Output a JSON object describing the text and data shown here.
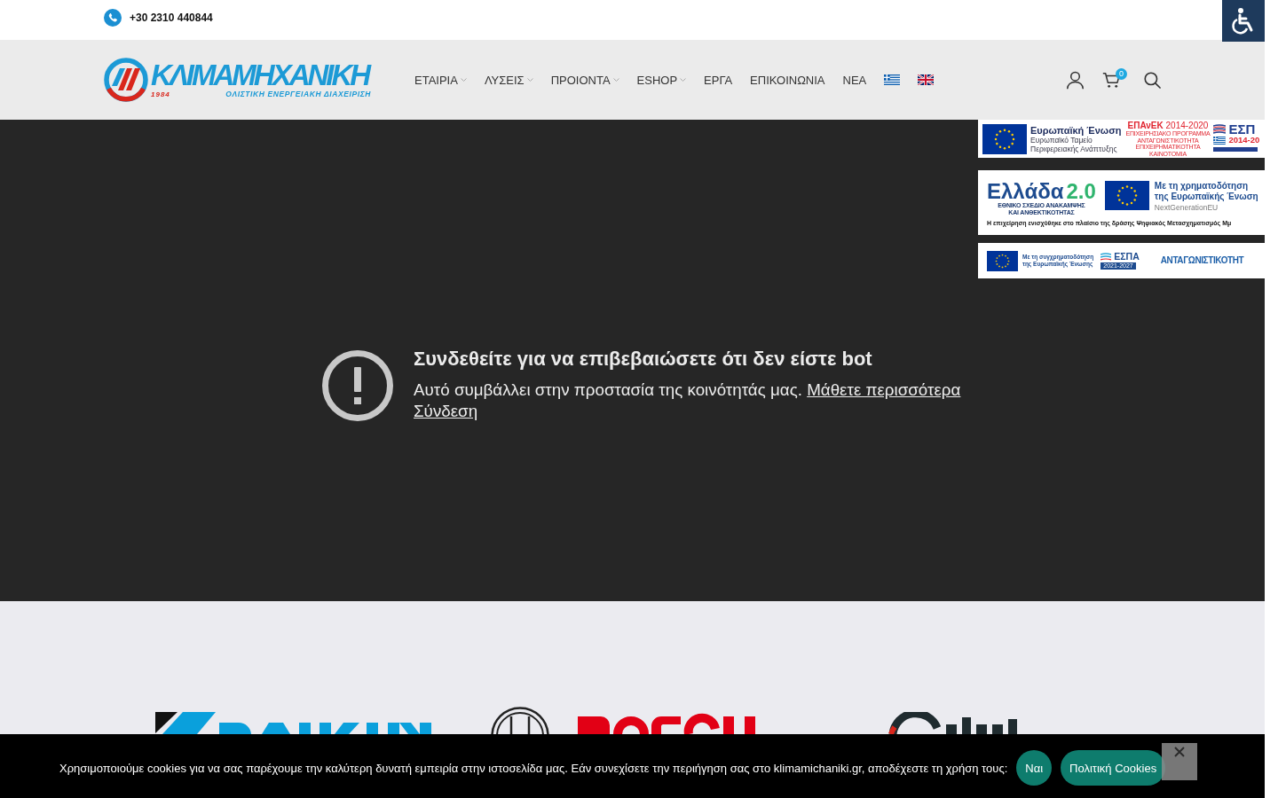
{
  "top_bar": {
    "phone": "+30 2310 440844"
  },
  "header": {
    "logo": {
      "name": "ΚΛΙΜΑΜΗΧΑΝΙΚΗ",
      "year": "1984",
      "tagline": "ΟΛΙΣΤΙΚΗ ΕΝΕΡΓΕΙΑΚΗ ΔΙΑΧΕΙΡΙΣΗ"
    },
    "nav": [
      {
        "label": "ΕΤΑΙΡΙΑ",
        "has_submenu": true
      },
      {
        "label": "ΛΥΣΕΙΣ",
        "has_submenu": true
      },
      {
        "label": "ΠΡΟΙΟΝΤΑ",
        "has_submenu": true
      },
      {
        "label": "ESHOP",
        "has_submenu": true
      },
      {
        "label": "ΕΡΓΑ",
        "has_submenu": false
      },
      {
        "label": "ΕΠΙΚΟΙΝΩΝΙΑ",
        "has_submenu": false
      },
      {
        "label": "ΝΕΑ",
        "has_submenu": false
      }
    ],
    "languages": [
      {
        "kind": "greek"
      },
      {
        "kind": "english"
      }
    ],
    "cart": {
      "count": "0"
    }
  },
  "video_embed": {
    "title": "Συνδεθείτε για να επιβεβαιώσετε ότι δεν είστε bot",
    "message": "Αυτό συμβάλλει στην προστασία της κοινότητάς μας.",
    "learn_more": "Μάθετε περισσότερα",
    "sign_in": "Σύνδεση"
  },
  "funding_banners": [
    {
      "kind": "epanek",
      "eu_title": "Ευρωπαϊκή Ένωση",
      "eu_lines": [
        "Ευρωπαϊκό Ταμείο",
        "Περιφερειακής Ανάπτυξης"
      ],
      "program_title": "**ΕΠΑνΕΚ** 2014-2020",
      "program_lines": [
        "ΕΠΙΧΕΙΡΗΣΙΑΚΟ ΠΡΟΓΡΑΜΜΑ",
        "ΑΝΤΑΓΩΝΙΣΤΙΚΟΤΗΤΑ",
        "ΕΠΙΧΕΙΡΗΜΑΤΙΚΟΤΗΤΑ",
        "ΚΑΙΝΟΤΟΜΙΑ"
      ],
      "espa_title": "ΕΣΠ",
      "espa_years": "2014-20"
    },
    {
      "kind": "greece_2_0",
      "brand": "Ελλάδα",
      "version": "2.0",
      "plan_lines": [
        "ΕΘΝΙΚΟ ΣΧΕΔΙΟ ΑΝΑΚΑΜΨΗΣ",
        "ΚΑΙ ΑΝΘΕΚΤΙΚΟΤΗΤΑΣ"
      ],
      "funding_lines": [
        "Με τη χρηματοδότηση",
        "της Ευρωπαϊκής Ένωση"
      ],
      "eu_program": "NextGenerationEU",
      "note": "Η επιχείρηση ενισχύθηκε στο πλαίσιο της δράσης Ψηφιακός Μετασχηματισμός Μμ"
    },
    {
      "kind": "espa_2021",
      "funding_lines": [
        "Με τη συγχρηματοδότηση",
        "της Ευρωπαϊκής Ένωσης"
      ],
      "espa_title": "ΕΣΠΑ",
      "espa_years": "2021-2027",
      "program_title": "ΑΝΤΑΓΩΝΙΣΤΙΚΟΤΗΤ"
    }
  ],
  "brand_logos": [
    {
      "kind": "daikin"
    },
    {
      "kind": "bosch"
    },
    {
      "kind": "ring"
    }
  ],
  "cookie_notice": {
    "text": "Χρησιμοποιούμε cookies για να σας παρέχουμε την καλύτερη δυνατή εμπειρία στην ιστοσελίδα μας. Εάν συνεχίσετε την περιήγηση σας στο klimamichaniki.gr, αποδέχεστε τη χρήση τους:",
    "buttons": [
      "Ναι",
      "Πολιτική Cookies"
    ]
  }
}
